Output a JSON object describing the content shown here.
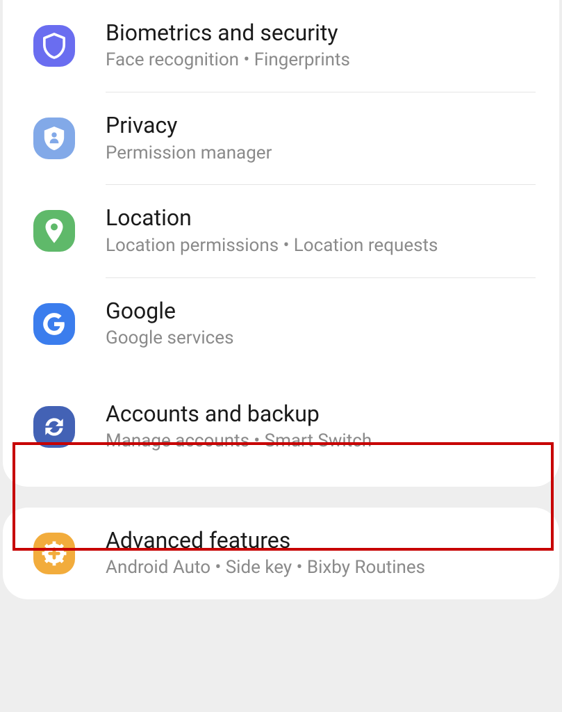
{
  "settings": {
    "items": [
      {
        "id": "biometrics",
        "title": "Biometrics and security",
        "subtitle": "Face recognition  •  Fingerprints",
        "icon": "shield-icon",
        "color": "#6a6df0"
      },
      {
        "id": "privacy",
        "title": "Privacy",
        "subtitle": "Permission manager",
        "icon": "privacy-shield-icon",
        "color": "#82a9e8"
      },
      {
        "id": "location",
        "title": "Location",
        "subtitle": "Location permissions  •  Location requests",
        "icon": "location-pin-icon",
        "color": "#5fb96a"
      },
      {
        "id": "google",
        "title": "Google",
        "subtitle": "Google services",
        "icon": "google-g-icon",
        "color": "#3b7ded"
      },
      {
        "id": "accounts",
        "title": "Accounts and backup",
        "subtitle": "Manage accounts  •  Smart Switch",
        "icon": "sync-icon",
        "color": "#4362b5"
      }
    ],
    "advanced": {
      "title": "Advanced features",
      "subtitle": "Android Auto  •  Side key  •  Bixby Routines",
      "icon": "plus-gear-icon",
      "color": "#f2ac3c"
    }
  }
}
